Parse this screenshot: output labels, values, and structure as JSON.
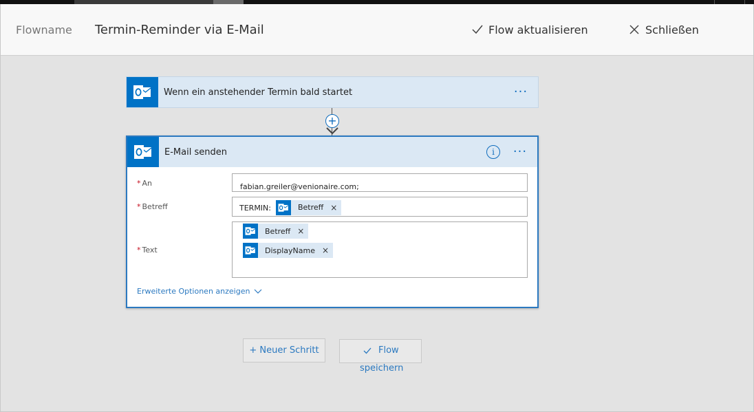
{
  "header": {
    "flow_label": "Flowname",
    "flow_title": "Termin-Reminder via E-Mail",
    "update_label": "Flow aktualisieren",
    "close_label": "Schließen"
  },
  "trigger": {
    "icon": "outlook-icon",
    "title": "Wenn ein anstehender Termin bald startet",
    "menu": "···"
  },
  "connector": {
    "add": "+"
  },
  "action": {
    "icon": "outlook-icon",
    "title": "E-Mail senden",
    "info": "i",
    "menu": "···",
    "fields": {
      "to": {
        "required_mark": "*",
        "label": "An",
        "value": "fabian.greiler@venionaire.com;"
      },
      "subject": {
        "required_mark": "*",
        "label": "Betreff",
        "prefix": "TERMIN:",
        "token": "Betreff"
      },
      "text": {
        "required_mark": "*",
        "label": "Text",
        "tokens": [
          "Betreff",
          "DisplayName"
        ]
      }
    },
    "advanced_link": "Erweiterte Optionen anzeigen"
  },
  "footer": {
    "new_step_label": "+ Neuer Schritt",
    "save_line1": "Flow",
    "save_line2": "speichern"
  },
  "colors": {
    "accent": "#0f6cbd",
    "outlook_blue": "#0072c6",
    "card_header": "#dbe8f4",
    "required": "#c50f1f"
  }
}
